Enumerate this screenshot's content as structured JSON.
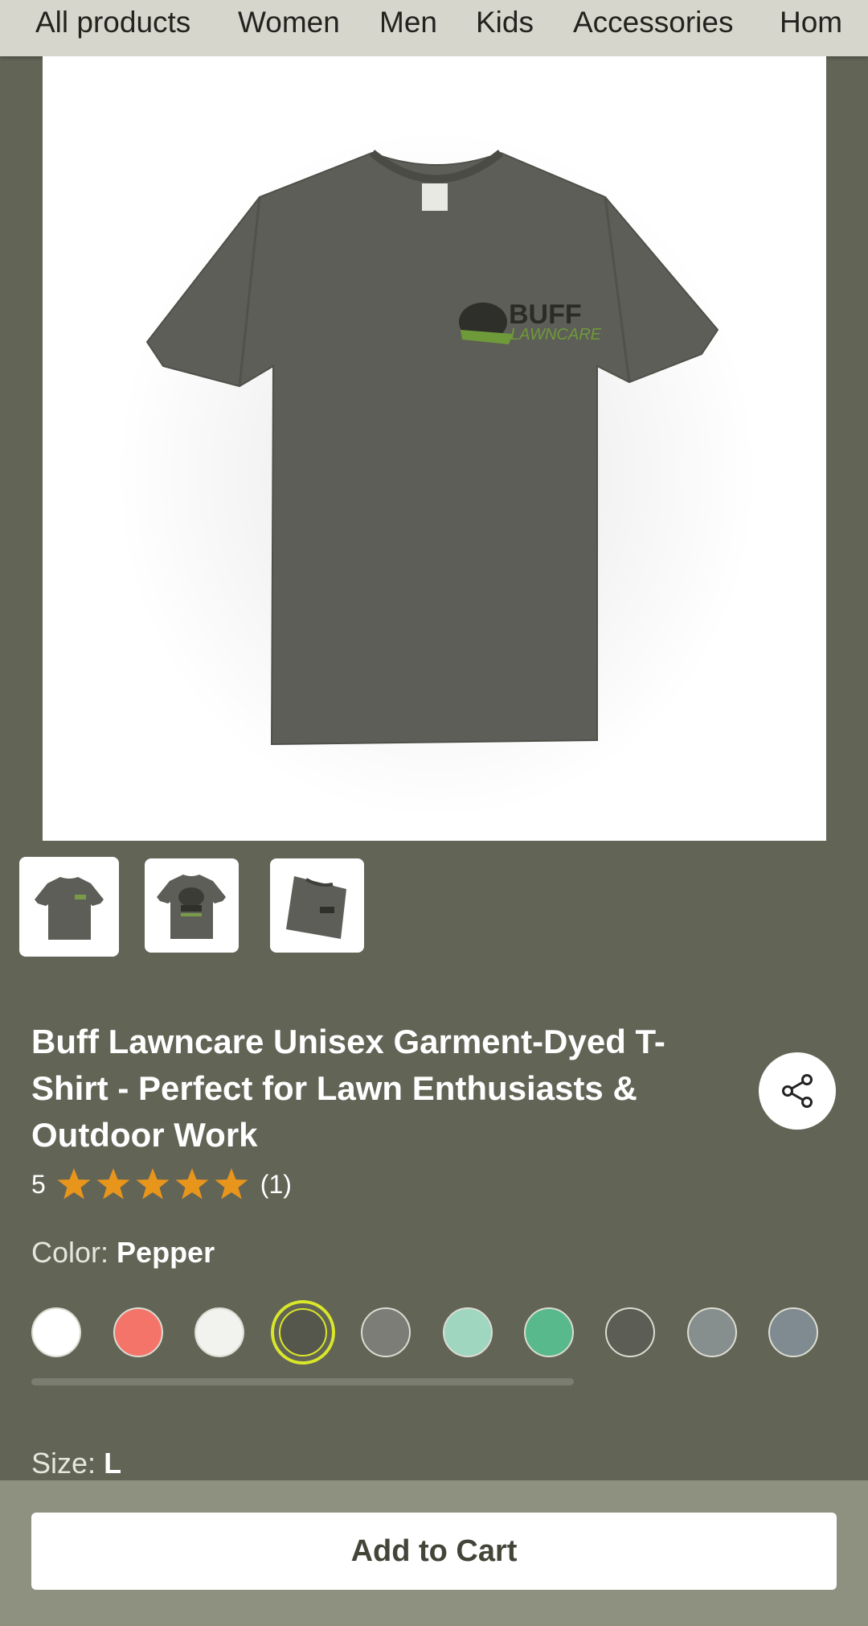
{
  "nav": {
    "items": [
      "All products",
      "Women",
      "Men",
      "Kids",
      "Accessories",
      "Hom"
    ]
  },
  "product": {
    "title": "Buff Lawncare Unisex Garment-Dyed T-Shirt - Perfect for Lawn Enthusiasts & Outdoor Work",
    "rating_value": "5",
    "rating_stars": 5,
    "review_count": "(1)",
    "shirt_logo_text": "BUFF LAWNCARE"
  },
  "thumbnails": [
    {
      "name": "front view",
      "selected": true
    },
    {
      "name": "back view",
      "selected": false
    },
    {
      "name": "folded view",
      "selected": false
    }
  ],
  "color": {
    "label": "Color:",
    "selected": "Pepper",
    "swatches": [
      "#ffffff",
      "#f5746a",
      "#f2f2ee",
      "#56574c",
      "#7b7d76",
      "#9fd6c0",
      "#57b98c",
      "#5c5e55",
      "#868e8e",
      "#7f8b90"
    ],
    "selected_index": 3
  },
  "size": {
    "label": "Size:",
    "selected": "L"
  },
  "actions": {
    "add_to_cart": "Add to Cart",
    "share_icon": "share-icon"
  },
  "colors": {
    "page_bg": "#626456",
    "nav_bg": "#d6d6cc",
    "star": "#e8951c",
    "selected_ring": "#d9e62a",
    "bottom_bar": "#8e9080"
  }
}
